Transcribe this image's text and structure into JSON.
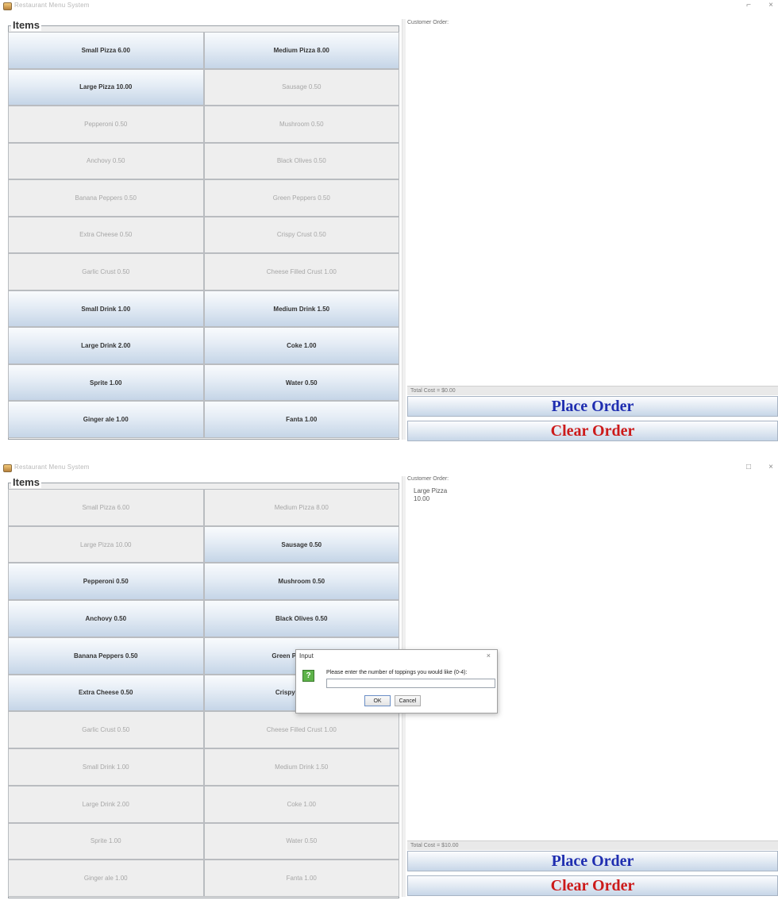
{
  "window1": {
    "title": "Restaurant Menu System",
    "controls": {
      "minimize": "⌐",
      "close": "×"
    },
    "items_title": "Items",
    "order_label": "Customer Order:",
    "order_lines": [],
    "total": "Total Cost = $0.00",
    "place_order": "Place Order",
    "clear_order": "Clear Order",
    "items": [
      {
        "label": "Small Pizza 6.00",
        "state": "on"
      },
      {
        "label": "Medium Pizza 8.00",
        "state": "on"
      },
      {
        "label": "Large Pizza 10.00",
        "state": "on"
      },
      {
        "label": "Sausage 0.50",
        "state": "off"
      },
      {
        "label": "Pepperoni 0.50",
        "state": "off"
      },
      {
        "label": "Mushroom 0.50",
        "state": "off"
      },
      {
        "label": "Anchovy 0.50",
        "state": "off"
      },
      {
        "label": "Black Olives 0.50",
        "state": "off"
      },
      {
        "label": "Banana Peppers 0.50",
        "state": "off"
      },
      {
        "label": "Green Peppers 0.50",
        "state": "off"
      },
      {
        "label": "Extra Cheese 0.50",
        "state": "off"
      },
      {
        "label": "Crispy Crust 0.50",
        "state": "off"
      },
      {
        "label": "Garlic Crust 0.50",
        "state": "off"
      },
      {
        "label": "Cheese Filled Crust 1.00",
        "state": "off"
      },
      {
        "label": "Small Drink 1.00",
        "state": "on"
      },
      {
        "label": "Medium Drink 1.50",
        "state": "on"
      },
      {
        "label": "Large Drink 2.00",
        "state": "on"
      },
      {
        "label": "Coke 1.00",
        "state": "on"
      },
      {
        "label": "Sprite 1.00",
        "state": "on"
      },
      {
        "label": "Water 0.50",
        "state": "on"
      },
      {
        "label": "Ginger ale 1.00",
        "state": "on"
      },
      {
        "label": "Fanta 1.00",
        "state": "on"
      }
    ]
  },
  "window2": {
    "title": "Restaurant Menu System",
    "controls": {
      "minimize": "□",
      "close": "×"
    },
    "items_title": "Items",
    "order_label": "Customer Order:",
    "order_lines": [
      "Large Pizza",
      "10.00"
    ],
    "total": "Total Cost = $10.00",
    "place_order": "Place Order",
    "clear_order": "Clear Order",
    "items": [
      {
        "label": "Small Pizza 6.00",
        "state": "off"
      },
      {
        "label": "Medium Pizza 8.00",
        "state": "off"
      },
      {
        "label": "Large Pizza 10.00",
        "state": "off"
      },
      {
        "label": "Sausage 0.50",
        "state": "on"
      },
      {
        "label": "Pepperoni 0.50",
        "state": "on"
      },
      {
        "label": "Mushroom 0.50",
        "state": "on"
      },
      {
        "label": "Anchovy 0.50",
        "state": "on"
      },
      {
        "label": "Black Olives 0.50",
        "state": "on"
      },
      {
        "label": "Banana Peppers 0.50",
        "state": "on"
      },
      {
        "label": "Green Peppers 0.50",
        "state": "on"
      },
      {
        "label": "Extra Cheese 0.50",
        "state": "on"
      },
      {
        "label": "Crispy Crust 0.50",
        "state": "on"
      },
      {
        "label": "Garlic Crust 0.50",
        "state": "off"
      },
      {
        "label": "Cheese Filled Crust 1.00",
        "state": "off"
      },
      {
        "label": "Small Drink 1.00",
        "state": "off"
      },
      {
        "label": "Medium Drink 1.50",
        "state": "off"
      },
      {
        "label": "Large Drink 2.00",
        "state": "off"
      },
      {
        "label": "Coke 1.00",
        "state": "off"
      },
      {
        "label": "Sprite 1.00",
        "state": "off"
      },
      {
        "label": "Water 0.50",
        "state": "off"
      },
      {
        "label": "Ginger ale 1.00",
        "state": "off"
      },
      {
        "label": "Fanta 1.00",
        "state": "off"
      }
    ]
  },
  "dialog": {
    "title": "Input",
    "close": "×",
    "icon": "?",
    "message": "Please enter the number of toppings you would like (0-4):",
    "input_value": "",
    "ok": "OK",
    "cancel": "Cancel"
  },
  "colors": {
    "place_order": "#1f2eb0",
    "clear_order": "#cc1a1a"
  }
}
